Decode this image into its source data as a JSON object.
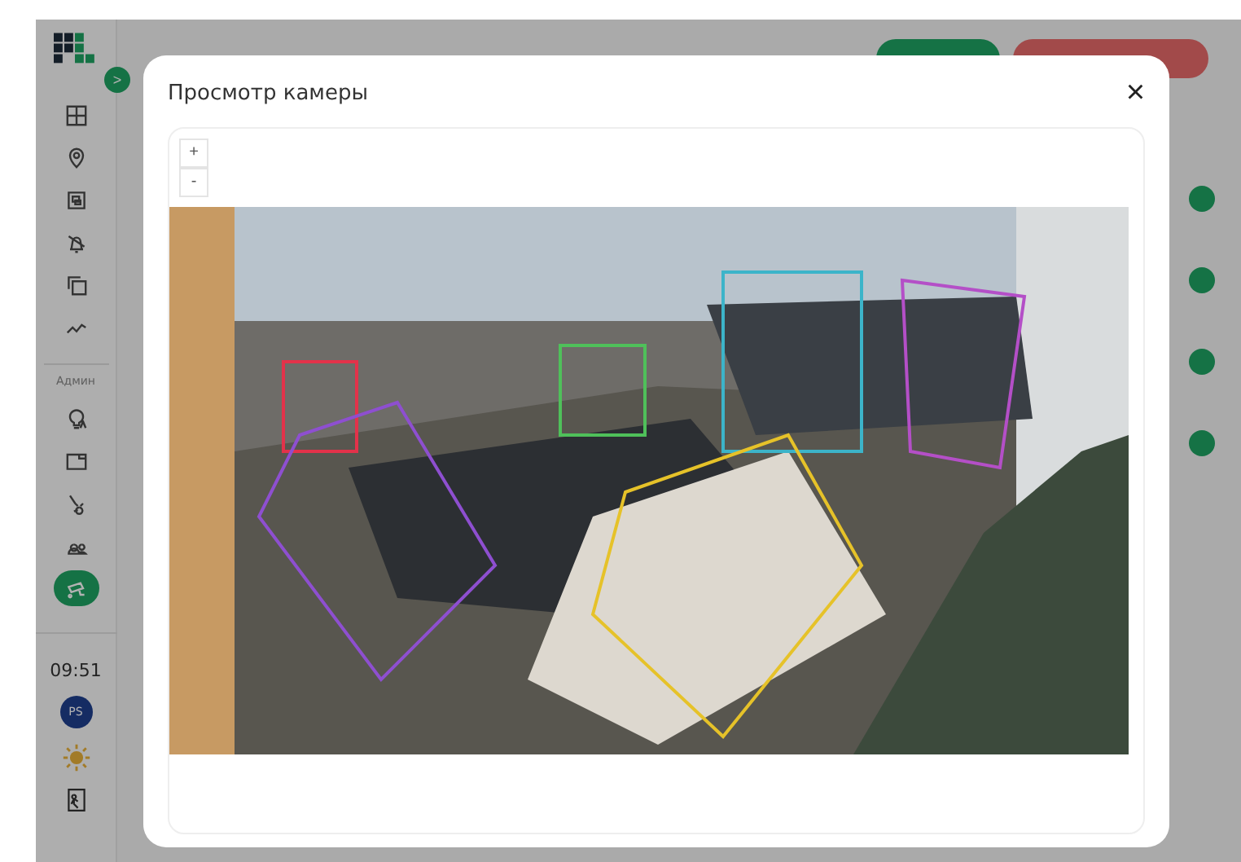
{
  "sidebar": {
    "toggle": ">",
    "nav": [
      {
        "kind": "grid",
        "selected": false
      },
      {
        "kind": "pin",
        "selected": false
      },
      {
        "kind": "frame",
        "selected": false
      },
      {
        "kind": "bell",
        "selected": false
      },
      {
        "kind": "copy",
        "selected": false
      },
      {
        "kind": "chart",
        "selected": false
      }
    ],
    "section_label": "Админ",
    "admin_nav": [
      {
        "kind": "bulb",
        "selected": false
      },
      {
        "kind": "zone",
        "selected": false
      },
      {
        "kind": "hub",
        "selected": false
      },
      {
        "kind": "users",
        "selected": false
      },
      {
        "kind": "camera",
        "selected": true
      }
    ],
    "time": "09:51",
    "avatar": "PS"
  },
  "modal": {
    "title": "Просмотр камеры",
    "close": "×",
    "zoom_in": "+",
    "zoom_out": "-"
  }
}
